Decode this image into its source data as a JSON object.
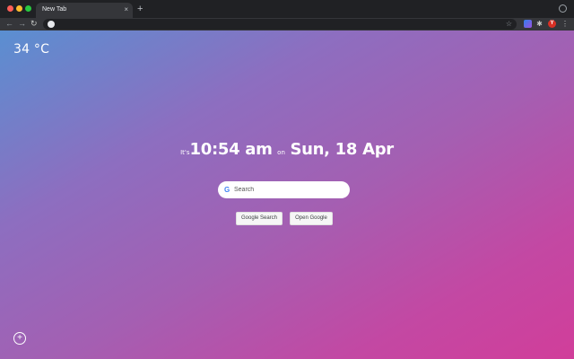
{
  "browser": {
    "tab_title": "New Tab",
    "tab_close": "×",
    "new_tab": "+",
    "nav_back": "←",
    "nav_forward": "→",
    "nav_reload": "↻",
    "bookmark_star": "☆",
    "extension_puzzle": "✱",
    "profile_initial": "Y",
    "menu": "⋮"
  },
  "page": {
    "weather": "34 °C",
    "clock": {
      "prefix": "It's",
      "time": "10:54 am",
      "on": "on",
      "date": "Sun, 18 Apr"
    },
    "search": {
      "placeholder": "Search",
      "google_g": "G"
    },
    "buttons": {
      "google_search": "Google Search",
      "open_google": "Open Google"
    },
    "settings_icon": "+"
  },
  "colors": {
    "gradient_start": "#5a8fd1",
    "gradient_end": "#d13e9a",
    "chrome_dark": "#202124",
    "toolbar": "#35363a"
  }
}
